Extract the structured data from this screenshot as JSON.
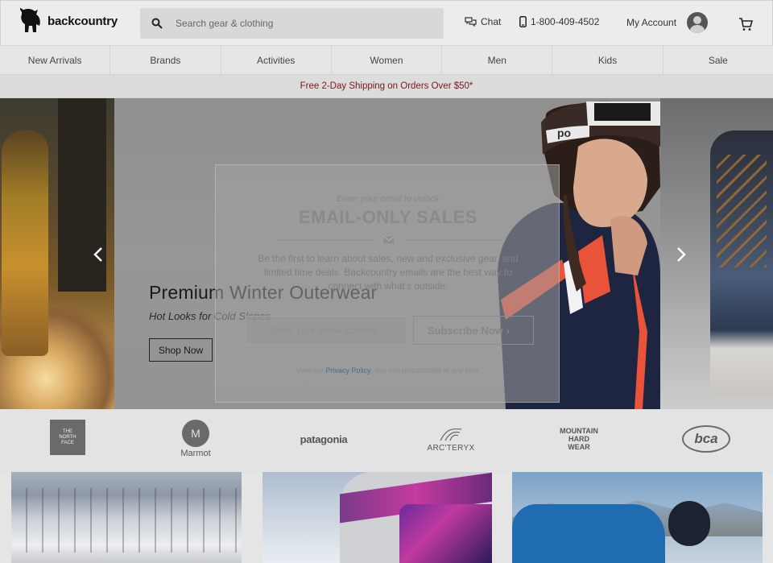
{
  "header": {
    "logo_text": "backcountry",
    "search_placeholder": "Search gear & clothing",
    "chat_label": "Chat",
    "phone": "1-800-409-4502",
    "account_label": "My Account"
  },
  "nav": {
    "items": [
      {
        "label": "New Arrivals"
      },
      {
        "label": "Brands"
      },
      {
        "label": "Activities"
      },
      {
        "label": "Women"
      },
      {
        "label": "Men"
      },
      {
        "label": "Kids"
      },
      {
        "label": "Sale"
      }
    ]
  },
  "promo": {
    "text": "Free 2-Day Shipping on Orders Over $50*"
  },
  "hero": {
    "title": "Premium Winter Outerwear",
    "subtitle": "Hot Looks for Cold Slopes",
    "cta": "Shop Now"
  },
  "modal": {
    "kicker": "Enter your email to unlock",
    "title": "EMAIL-ONLY SALES",
    "body": "Be the first to learn about sales, new and exclusive gear, and limited time deals. Backcountry emails are the best way to connect with what's outside.",
    "email_placeholder": "Enter your email address",
    "subscribe_label": "Subscribe Now ›",
    "fine_prefix": "View our",
    "privacy_link": "Privacy Policy",
    "fine_suffix": ". You can unsubscribe at any time."
  },
  "brands": {
    "tnf": "THE NORTH FACE",
    "marmot": "Marmot",
    "patagonia": "patagonia",
    "arcteryx": "ARC'TERYX",
    "mhw_1": "MOUNTAIN",
    "mhw_2": "HARD",
    "mhw_3": "WEAR",
    "bca": "bca"
  },
  "colors": {
    "promo_text": "#7a1818",
    "privacy_link": "#4a6a8a"
  }
}
